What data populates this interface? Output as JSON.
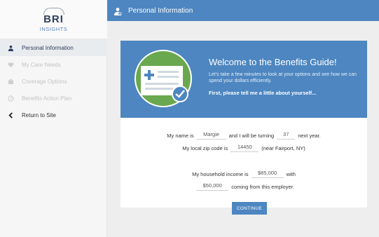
{
  "logo": {
    "main": "BRI",
    "sub": "INSIGHTS"
  },
  "header": {
    "title": "Personal Information",
    "icon": "person-icon"
  },
  "sidebar": {
    "items": [
      {
        "label": "Personal Information",
        "icon": "person-icon",
        "state": "active"
      },
      {
        "label": "My Care Needs",
        "icon": "heart-icon",
        "state": "disabled"
      },
      {
        "label": "Coverage Options",
        "icon": "briefcase-icon",
        "state": "disabled"
      },
      {
        "label": "Benefits Action Plan",
        "icon": "clock-icon",
        "state": "disabled"
      },
      {
        "label": "Return to Site",
        "icon": "chevron-left-icon",
        "state": "normal"
      }
    ]
  },
  "welcome": {
    "title": "Welcome to the Benefits Guide!",
    "text": "Let's take a few minutes to look at your options and see how we can spend your dollars efficiently.",
    "cta": "First, please tell me a little about yourself..."
  },
  "form": {
    "name_prefix": "My name is",
    "name_value": "Margie",
    "age_prefix": "and I will be turning",
    "age_value": "37",
    "age_suffix": "next year.",
    "zip_prefix": "My local zip code is",
    "zip_value": "14450",
    "zip_suffix": "(near Fairport, NY)",
    "income_prefix": "My household income is",
    "income_value": "$85,000",
    "income_suffix": "with",
    "employer_value": "$50,000",
    "employer_suffix": "coming from this employer."
  },
  "buttons": {
    "continue": "CONTINUE"
  },
  "colors": {
    "accent": "#4d86c0",
    "brand_dark": "#2f3f62",
    "green": "#6aa84f"
  }
}
